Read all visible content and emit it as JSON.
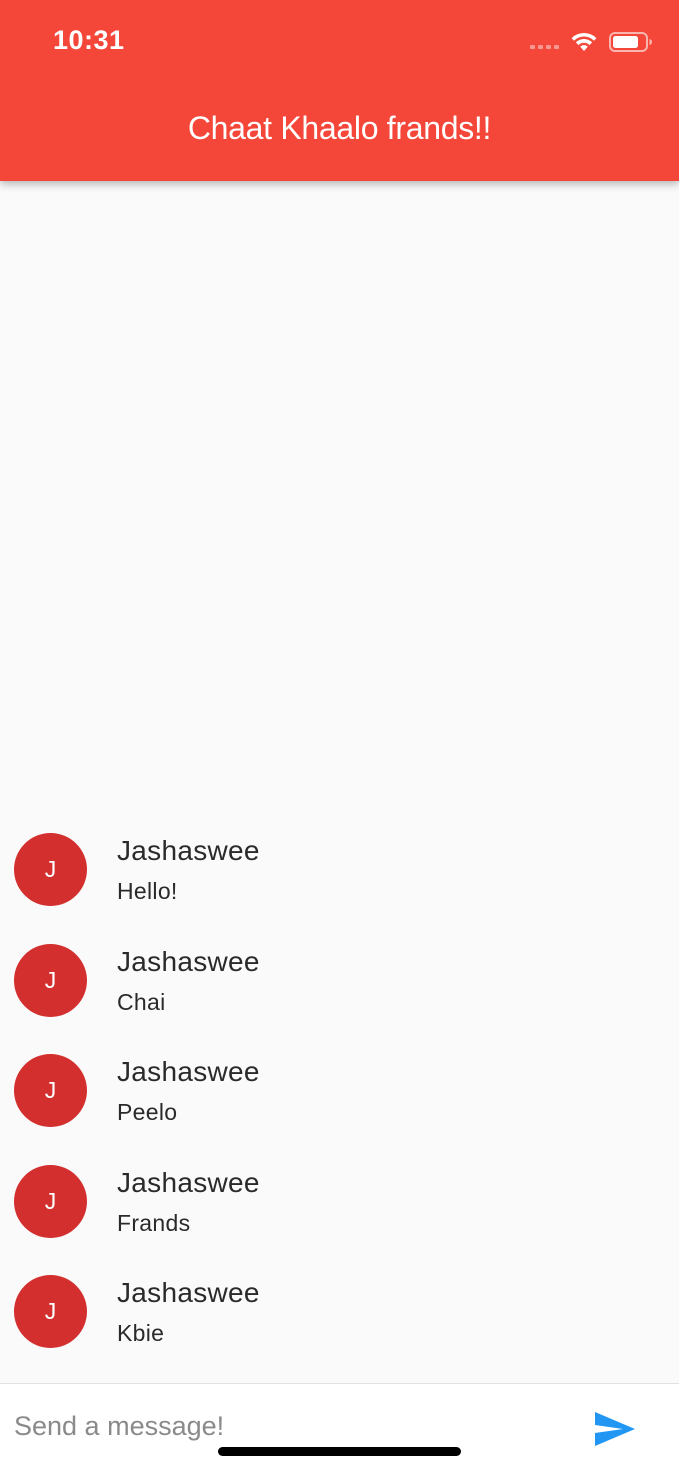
{
  "status_bar": {
    "time": "10:31"
  },
  "app_bar": {
    "title": "Chaat Khaalo frands!!",
    "color": "#f44639"
  },
  "messages": [
    {
      "avatar_letter": "J",
      "sender": "Jashaswee",
      "text": "Hello!"
    },
    {
      "avatar_letter": "J",
      "sender": "Jashaswee",
      "text": "Chai"
    },
    {
      "avatar_letter": "J",
      "sender": "Jashaswee",
      "text": "Peelo"
    },
    {
      "avatar_letter": "J",
      "sender": "Jashaswee",
      "text": "Frands"
    },
    {
      "avatar_letter": "J",
      "sender": "Jashaswee",
      "text": "Kbie"
    }
  ],
  "composer": {
    "placeholder": "Send a message!",
    "value": "",
    "send_icon": "send-icon",
    "send_color": "#2196f3"
  },
  "avatar_color": "#d32f2f"
}
